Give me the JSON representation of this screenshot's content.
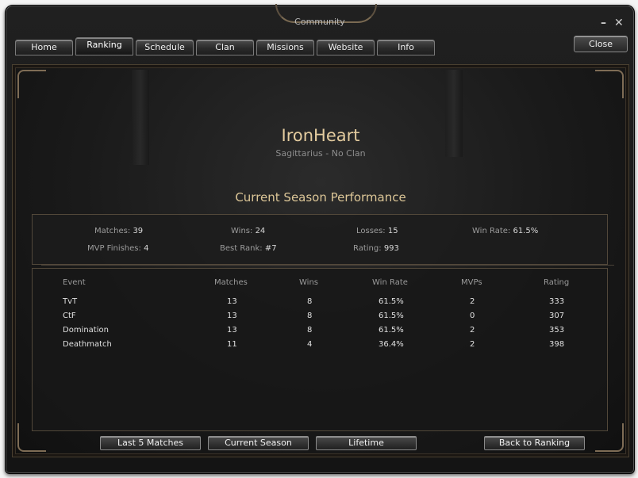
{
  "window": {
    "title": "Community",
    "minimize_glyph": "–",
    "close_glyph": "✕"
  },
  "tabs": [
    {
      "label": "Home",
      "active": false
    },
    {
      "label": "Ranking",
      "active": true
    },
    {
      "label": "Schedule",
      "active": false
    },
    {
      "label": "Clan",
      "active": false
    },
    {
      "label": "Missions",
      "active": false
    },
    {
      "label": "Website",
      "active": false
    },
    {
      "label": "Info",
      "active": false
    }
  ],
  "close_label": "Close",
  "player": {
    "name": "IronHeart",
    "subtitle": "Sagittarius - No Clan"
  },
  "section_title": "Current Season Performance",
  "summary": {
    "matches_label": "Matches:",
    "matches": "39",
    "wins_label": "Wins:",
    "wins": "24",
    "losses_label": "Losses:",
    "losses": "15",
    "win_rate_label": "Win Rate:",
    "win_rate": "61.5%",
    "mvp_label": "MVP Finishes:",
    "mvp": "4",
    "best_rank_label": "Best Rank:",
    "best_rank": "#7",
    "rating_label": "Rating:",
    "rating": "993"
  },
  "table": {
    "headers": [
      "Event",
      "Matches",
      "Wins",
      "Win Rate",
      "MVPs",
      "Rating"
    ],
    "rows": [
      [
        "TvT",
        "13",
        "8",
        "61.5%",
        "2",
        "333"
      ],
      [
        "CtF",
        "13",
        "8",
        "61.5%",
        "0",
        "307"
      ],
      [
        "Domination",
        "13",
        "8",
        "61.5%",
        "2",
        "353"
      ],
      [
        "Deathmatch",
        "11",
        "4",
        "36.4%",
        "2",
        "398"
      ]
    ]
  },
  "buttons": {
    "last5": "Last 5 Matches",
    "current_season": "Current Season",
    "lifetime": "Lifetime",
    "back": "Back to Ranking"
  },
  "colors": {
    "accent_gold": "#e4cc9f",
    "frame_bronze": "#7e6c55",
    "panel_bg": "#1a1a1a"
  }
}
